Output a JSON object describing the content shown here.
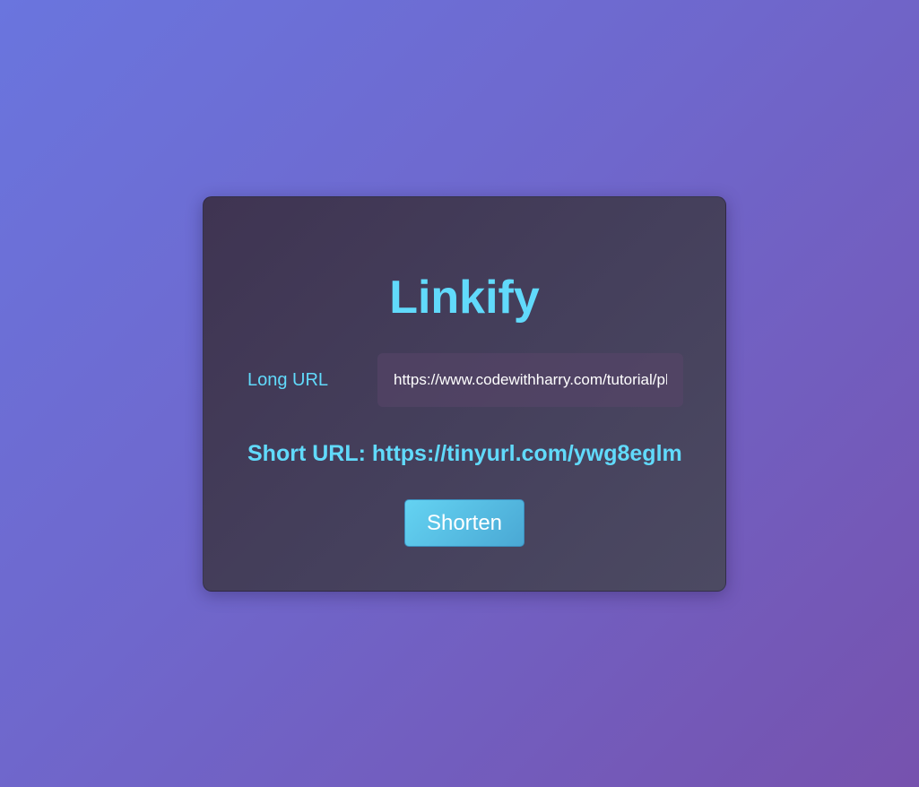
{
  "app": {
    "title": "Linkify"
  },
  "form": {
    "long_url_label": "Long URL",
    "long_url_value": "https://www.codewithharry.com/tutorial/pl",
    "short_url_text": "Short URL: https://tinyurl.com/ywg8eglm",
    "shorten_label": "Shorten"
  },
  "colors": {
    "accent": "#61dafb",
    "card_bg": "#45405c",
    "page_bg_start": "#6a75de",
    "page_bg_end": "#7652ae"
  }
}
